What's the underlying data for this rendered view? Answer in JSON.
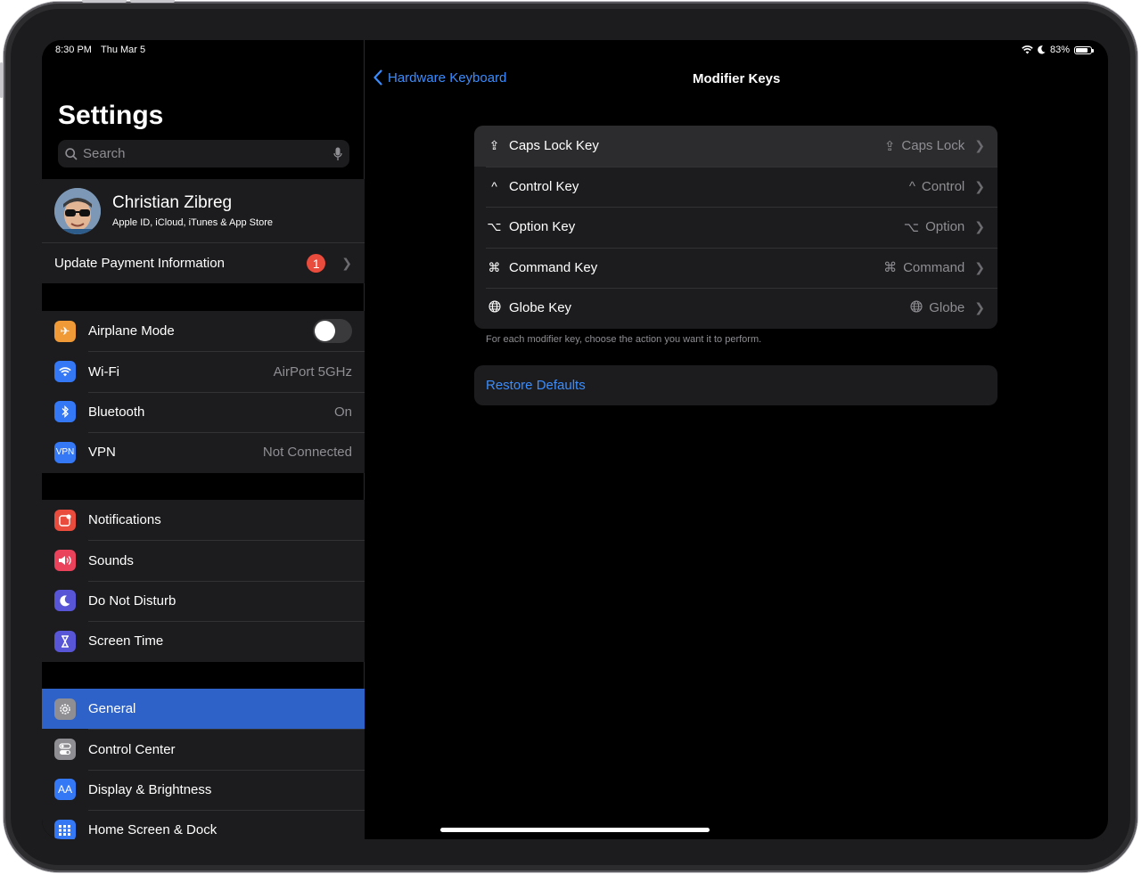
{
  "status": {
    "time": "8:30 PM",
    "date": "Thu Mar 5",
    "battery": "83%"
  },
  "sidebar": {
    "title": "Settings",
    "search_placeholder": "Search",
    "profile": {
      "name": "Christian Zibreg",
      "subtitle": "Apple ID, iCloud, iTunes & App Store"
    },
    "payment": {
      "label": "Update Payment Information",
      "badge": "1"
    },
    "group1": [
      {
        "label": "Airplane Mode",
        "value": "",
        "color": "#f09a37"
      },
      {
        "label": "Wi-Fi",
        "value": "AirPort 5GHz",
        "color": "#3478f6"
      },
      {
        "label": "Bluetooth",
        "value": "On",
        "color": "#3478f6"
      },
      {
        "label": "VPN",
        "value": "Not Connected",
        "color": "#3478f6",
        "icon_text": "VPN"
      }
    ],
    "group2": [
      {
        "label": "Notifications",
        "color": "#e94b3c"
      },
      {
        "label": "Sounds",
        "color": "#e9425a"
      },
      {
        "label": "Do Not Disturb",
        "color": "#5856d6"
      },
      {
        "label": "Screen Time",
        "color": "#5856d6"
      }
    ],
    "group3": [
      {
        "label": "General",
        "color": "#8e8e93"
      },
      {
        "label": "Control Center",
        "color": "#8e8e93"
      },
      {
        "label": "Display & Brightness",
        "color": "#3478f6",
        "icon_text": "AA"
      },
      {
        "label": "Home Screen & Dock",
        "color": "#3478f6"
      }
    ]
  },
  "detail": {
    "back_label": "Hardware Keyboard",
    "title": "Modifier Keys",
    "keys": [
      {
        "label": "Caps Lock Key",
        "value": "Caps Lock",
        "glyph": "⇪"
      },
      {
        "label": "Control Key",
        "value": "Control",
        "glyph": "^"
      },
      {
        "label": "Option Key",
        "value": "Option",
        "glyph": "⌥"
      },
      {
        "label": "Command Key",
        "value": "Command",
        "glyph": "⌘"
      },
      {
        "label": "Globe Key",
        "value": "Globe",
        "glyph": "🌐"
      }
    ],
    "footnote": "For each modifier key, choose the action you want it to perform.",
    "restore_label": "Restore Defaults"
  }
}
